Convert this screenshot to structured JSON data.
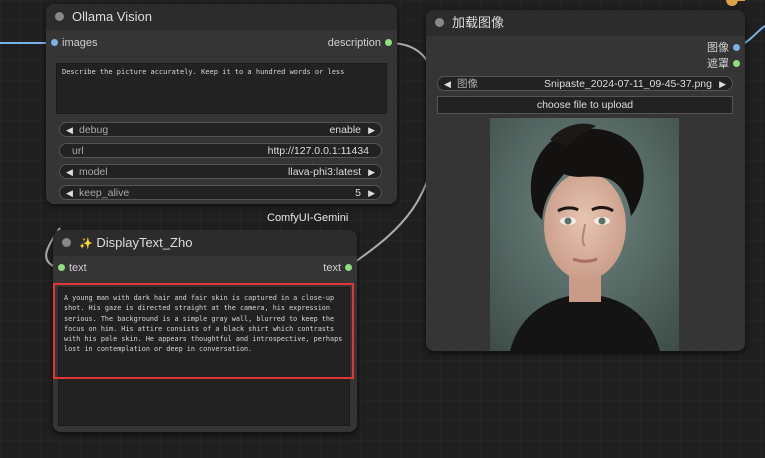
{
  "ollama_node": {
    "title": "Ollama Vision",
    "input_images": "images",
    "output_description": "description",
    "prompt_text": "Describe the picture accurately. Keep it to a hundred words or less",
    "widgets": [
      {
        "label": "debug",
        "value": "enable"
      },
      {
        "label": "url",
        "value": "http://127.0.0.1:11434"
      },
      {
        "label": "model",
        "value": "llava-phi3:latest"
      },
      {
        "label": "keep_alive",
        "value": "5"
      }
    ]
  },
  "gemini_label": "ComfyUI-Gemini",
  "display_node": {
    "title_icon": "✨",
    "title": "DisplayText_Zho",
    "input_text": "text",
    "output_text": "text",
    "output_content": "A young man with dark hair and fair skin is captured in a close-up shot. His gaze is directed straight at the camera, his expression serious. The background is a simple gray wall, blurred to keep the focus on him. His attire consists of a black shirt which contrasts with his pale skin. He appears thoughtful and introspective, perhaps lost in contemplation or deep in conversation."
  },
  "load_image_node": {
    "title": "加载图像",
    "output_image": "图像",
    "output_mask": "遮罩",
    "image_widget_label": "图像",
    "image_widget_value": "Snipaste_2024-07-11_09-45-37.png",
    "upload_button": "choose file to upload"
  },
  "colors": {
    "highlight_border": "#e23535",
    "image_slot": "#7ab2e8",
    "string_slot": "#8ee07a"
  }
}
